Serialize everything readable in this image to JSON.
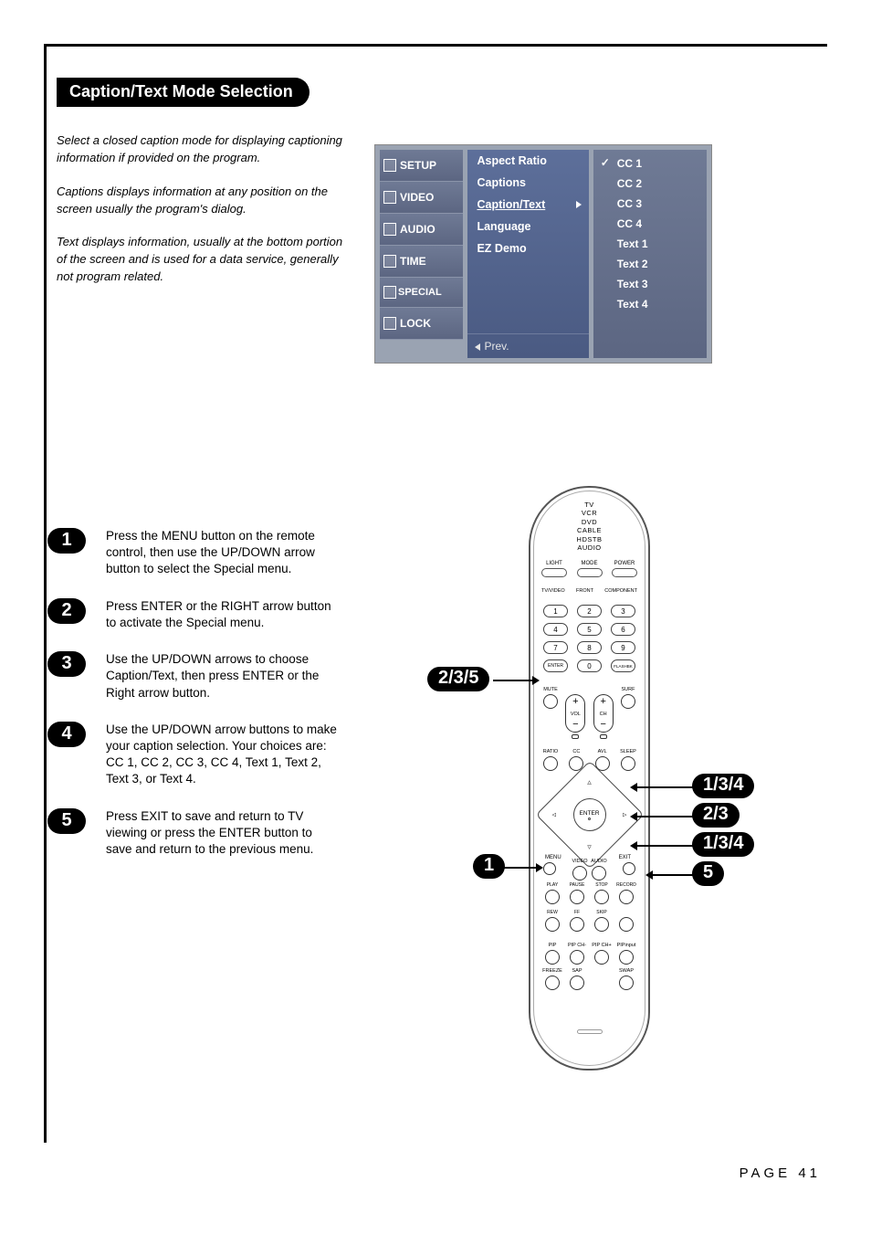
{
  "title": "Caption/Text Mode Selection",
  "intro": {
    "p1": "Select a closed caption mode for displaying captioning information if provided on the program.",
    "p2": "Captions displays information at any position on the screen usually the program's dialog.",
    "p3": "Text displays information, usually at the bottom portion of the screen and is used for a data service, generally not program related."
  },
  "osd": {
    "tabs": [
      "SETUP",
      "VIDEO",
      "AUDIO",
      "TIME",
      "SPECIAL",
      "LOCK"
    ],
    "items": {
      "aspect": "Aspect Ratio",
      "captions": "Captions",
      "captiontext": "Caption/Text",
      "language": "Language",
      "ezdemo": "EZ Demo"
    },
    "prev": "Prev.",
    "options": [
      "CC 1",
      "CC 2",
      "CC 3",
      "CC 4",
      "Text 1",
      "Text 2",
      "Text 3",
      "Text 4"
    ]
  },
  "steps": {
    "s1": "Press the MENU button on the remote control, then use the UP/DOWN arrow button to select the Special menu.",
    "s2": "Press ENTER or the RIGHT arrow button to activate the Special menu.",
    "s3": "Use the UP/DOWN arrows to choose Caption/Text, then press ENTER or the Right arrow button.",
    "s4": "Use the UP/DOWN arrow buttons to make your caption selection. Your choices are: CC 1, CC 2, CC 3, CC 4, Text 1, Text 2, Text 3, or Text 4.",
    "s5": "Press EXIT to save and return to TV viewing or press the ENTER button to save and return to the previous menu."
  },
  "step_labels": {
    "s1": "1",
    "s2": "2",
    "s3": "3",
    "s4": "4",
    "s5": "5"
  },
  "remote": {
    "modes": "TV\nVCR\nDVD\nCABLE\nHDSTB\nAUDIO",
    "top_labels": {
      "light": "LIGHT",
      "mode": "MODE",
      "power": "POWER"
    },
    "under_labels": {
      "tvvideo": "TV/VIDEO",
      "front": "FRONT",
      "component": "COMPONENT"
    },
    "nums": [
      "1",
      "2",
      "3",
      "4",
      "5",
      "6",
      "7",
      "8",
      "9",
      "ENTER",
      "0",
      "FLASHBK"
    ],
    "rocker": {
      "mute": "MUTE",
      "vol": "VOL",
      "ch": "CH",
      "surf": "SURF"
    },
    "row1": {
      "ratio": "RATIO",
      "cc": "CC",
      "avl": "AVL",
      "sleep": "SLEEP"
    },
    "dpad": "ENTER",
    "corners": {
      "menu": "MENU",
      "exit": "EXIT",
      "video": "VIDEO",
      "audio": "AUDIO"
    },
    "media1": {
      "play": "PLAY",
      "pause": "PAUSE",
      "stop": "STOP",
      "record": "RECORD"
    },
    "media2": {
      "rew": "REW",
      "ff": "FF",
      "skip": "SKIP"
    },
    "pip1": {
      "pip": "PIP",
      "pipchm": "PIP CH-",
      "pipchp": "PIP CH+",
      "pipinput": "PIPinput"
    },
    "pip2": {
      "freeze": "FREEZE",
      "sap": "SAP",
      "swap": "SWAP"
    }
  },
  "callouts": {
    "c235": "2/3/5",
    "c1": "1",
    "c134a": "1/3/4",
    "c23": "2/3",
    "c134b": "1/3/4",
    "c5": "5"
  },
  "footer": "PAGE 41"
}
